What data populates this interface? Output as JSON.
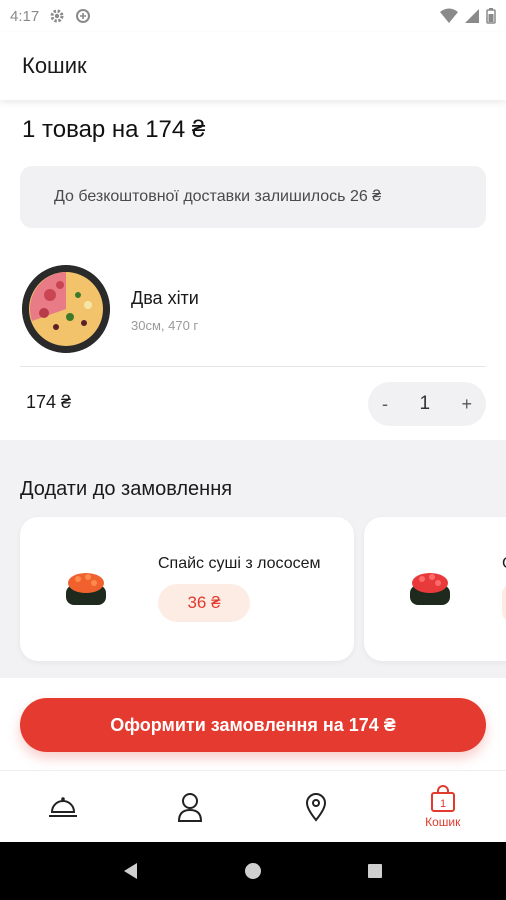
{
  "status_bar": {
    "time": "4:17"
  },
  "app_bar": {
    "title": "Кошик"
  },
  "cart": {
    "summary": "1 товар на 174 ₴",
    "delivery_note": "До безкоштовної доставки залишилось 26 ₴",
    "items": [
      {
        "name": "Два хіти",
        "meta": "30см, 470 г",
        "price": "174 ₴",
        "quantity": "1",
        "minus": "-",
        "plus": "+"
      }
    ]
  },
  "upsell": {
    "title": "Додати до замовлення",
    "cards": [
      {
        "name": "Спайс суші з лососем",
        "price": "36 ₴"
      },
      {
        "name": "С",
        "price": ""
      }
    ]
  },
  "checkout": {
    "button_label": "Оформити замовлення на 174 ₴"
  },
  "bottom_nav": {
    "items": [
      {
        "icon": "cloche-icon",
        "label": ""
      },
      {
        "icon": "user-icon",
        "label": ""
      },
      {
        "icon": "location-pin-icon",
        "label": ""
      },
      {
        "icon": "bag-icon",
        "label": "Кошик",
        "badge": "1",
        "active": true
      }
    ]
  },
  "colors": {
    "accent": "#e53a2f",
    "pill_bg": "#fdece4",
    "muted_bg": "#f1f1f3"
  }
}
